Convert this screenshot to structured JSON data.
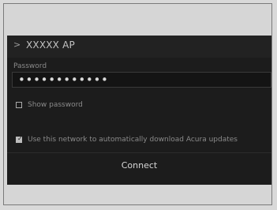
{
  "window": {
    "ssid": "XXXXX AP"
  },
  "form": {
    "password_label": "Password",
    "password_value": "••••••••••••",
    "show_password": {
      "label": "Show password",
      "checked": false
    },
    "auto_download": {
      "label": "Use this network to automatically download Acura updates",
      "checked": true
    },
    "connect_label": "Connect"
  },
  "colors": {
    "screen_bg": "#1c1c1c",
    "text": "#bdbdbd",
    "muted_text": "#8a8a8a",
    "outer_bg": "#d9d9d9"
  },
  "icons": {
    "back": "chevron-right-icon",
    "checkbox": "checkbox-icon",
    "checkmark": "check-icon"
  }
}
